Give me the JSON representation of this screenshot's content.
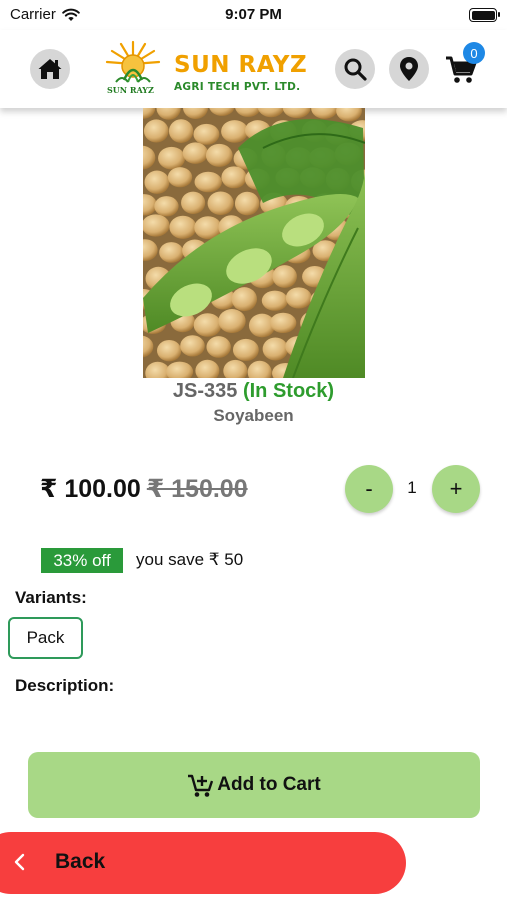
{
  "status_bar": {
    "carrier": "Carrier",
    "time": "9:07 PM",
    "battery_level": 1.0
  },
  "header": {
    "logo": {
      "brand": "SUN RAYZ",
      "subtitle": "AGRI TECH PVT. LTD.",
      "tagline": "SUN RAYZ"
    },
    "icons": [
      "home-icon",
      "search-icon",
      "location-pin-icon",
      "cart-icon"
    ],
    "cart_count": "0",
    "colors": {
      "icon_circle": "#d6d6d6",
      "brand_orange": "#f0a000",
      "brand_green": "#2b8a2b",
      "badge_blue": "#1e88e5"
    }
  },
  "product": {
    "name": "JS-335",
    "stock_status": "(In Stock)",
    "category": "Soyabeen",
    "price": "₹ 100.00",
    "mrp": "₹ 150.00",
    "discount_badge": "33% off",
    "savings_text": "you save ₹ 50",
    "quantity": "1",
    "quantity_minus": "-",
    "quantity_plus": "+",
    "colors": {
      "stock_green": "#2e9c2e",
      "accent_green": "#a8d886",
      "badge_green": "#2a9a3a"
    }
  },
  "variants": {
    "label": "Variants:",
    "options": [
      "Pack"
    ],
    "selected": "Pack"
  },
  "description": {
    "label": "Description:"
  },
  "actions": {
    "add_to_cart": "Add to Cart",
    "back": "Back",
    "colors": {
      "add_to_cart_bg": "#a8d886",
      "back_bg": "#f73e3e"
    }
  }
}
